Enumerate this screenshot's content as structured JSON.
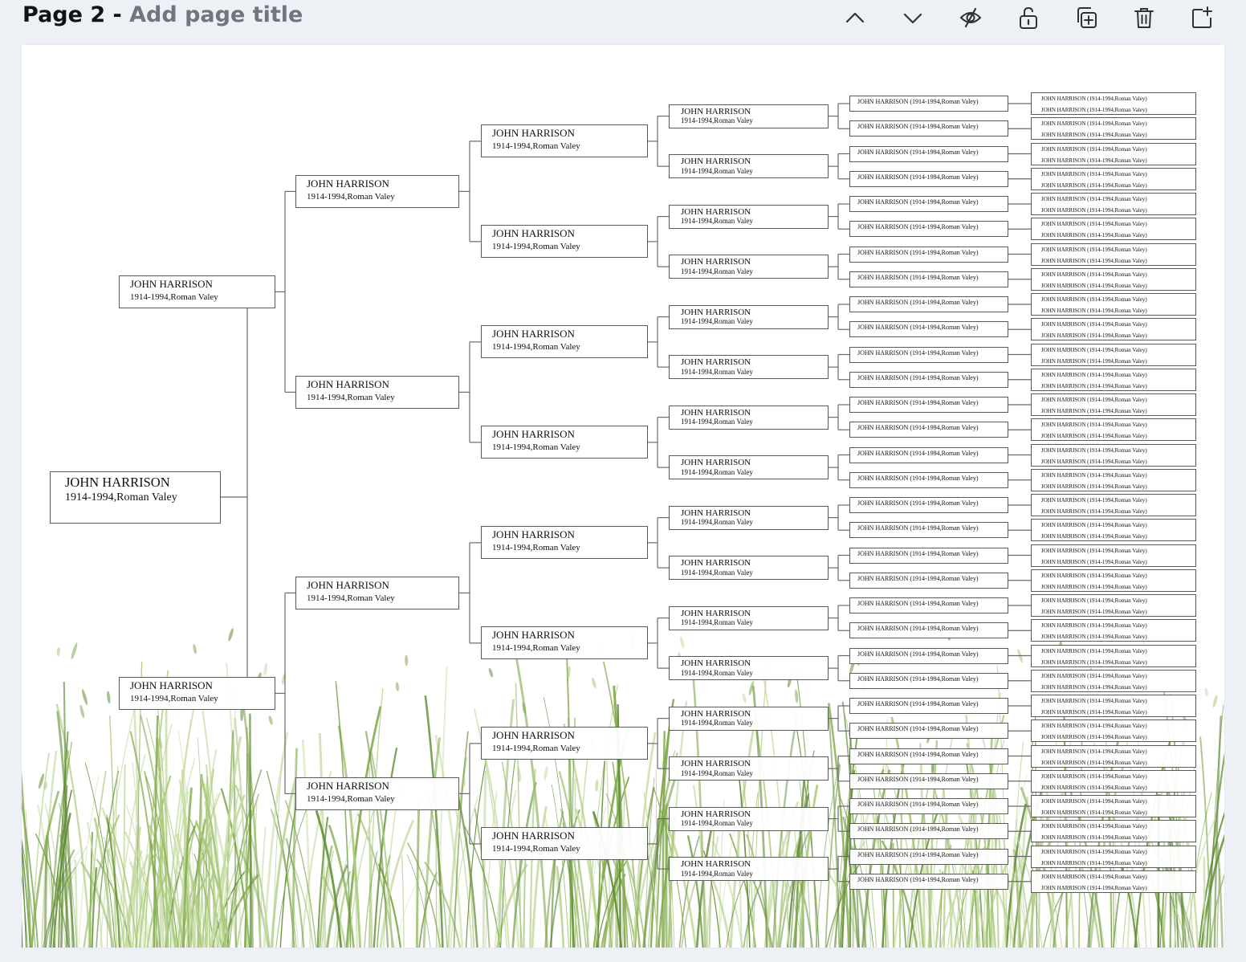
{
  "header": {
    "page_label": "Page 2 - ",
    "title_placeholder": "Add page title",
    "actions": [
      {
        "name": "move-page-up",
        "icon": "chevron-up-icon"
      },
      {
        "name": "move-page-down",
        "icon": "chevron-down-icon"
      },
      {
        "name": "hide-page",
        "icon": "eye-slash-icon"
      },
      {
        "name": "lock-page",
        "icon": "lock-icon"
      },
      {
        "name": "duplicate-page",
        "icon": "duplicate-icon"
      },
      {
        "name": "delete-page",
        "icon": "trash-icon"
      },
      {
        "name": "add-page",
        "icon": "add-page-icon"
      }
    ]
  },
  "canvas": {
    "background": "#ffffff",
    "decoration": "grass-illustration",
    "grass_colors": [
      "#7fa84a",
      "#a9c97a",
      "#5f8c35",
      "#c4dba0"
    ]
  },
  "tree": {
    "generations": [
      {
        "count": 1,
        "name": "JOHN HARRISON",
        "dates": "1914-1994,Roman Valey"
      },
      {
        "count": 2,
        "name": "JOHN HARRISON",
        "dates": "1914-1994,Roman Valey"
      },
      {
        "count": 4,
        "name": "JOHN HARRISON",
        "dates": "1914-1994,Roman Valey"
      },
      {
        "count": 8,
        "name": "JOHN HARRISON",
        "dates": "1914-1994,Roman Valey"
      },
      {
        "count": 16,
        "name": "JOHN HARRISON",
        "dates": "1914-1994,Roman Valey"
      },
      {
        "count": 32,
        "text": "JOHN HARRISON (1914-1994,Roman Valey)"
      },
      {
        "count": 32,
        "text": "JOHN HARRISON (1914-1994,Roman Valey)",
        "lines_per_box": 2
      }
    ]
  }
}
